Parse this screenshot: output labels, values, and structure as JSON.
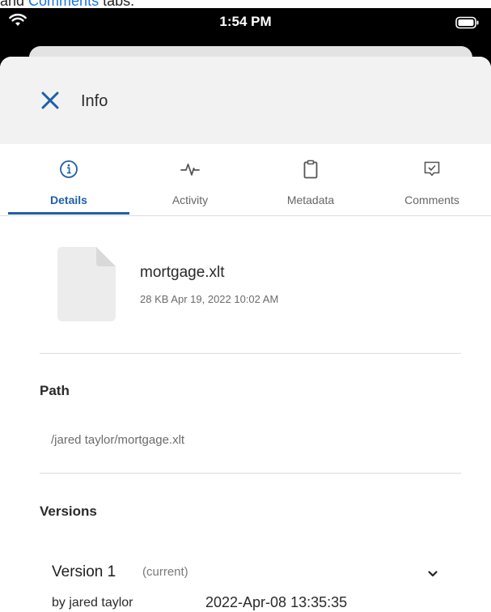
{
  "caption": {
    "text_before": "and ",
    "link": "Comments",
    "text_after": " tabs."
  },
  "status_bar": {
    "time": "1:54 PM"
  },
  "header": {
    "title": "Info"
  },
  "tabs": [
    {
      "label": "Details",
      "icon": "info-icon",
      "active": true
    },
    {
      "label": "Activity",
      "icon": "activity-icon",
      "active": false
    },
    {
      "label": "Metadata",
      "icon": "clipboard-icon",
      "active": false
    },
    {
      "label": "Comments",
      "icon": "comment-icon",
      "active": false
    }
  ],
  "file": {
    "name": "mortgage.xlt",
    "meta": "28 KB Apr 19, 2022 10:02 AM"
  },
  "path": {
    "title": "Path",
    "value": "/jared taylor/mortgage.xlt"
  },
  "versions": {
    "title": "Versions",
    "items": [
      {
        "label": "Version 1",
        "status": "(current)",
        "author": "by jared taylor",
        "date": "2022-Apr-08 13:35:35"
      }
    ]
  },
  "colors": {
    "accent": "#1f5fa6",
    "header_bg": "#f2f2f2"
  }
}
